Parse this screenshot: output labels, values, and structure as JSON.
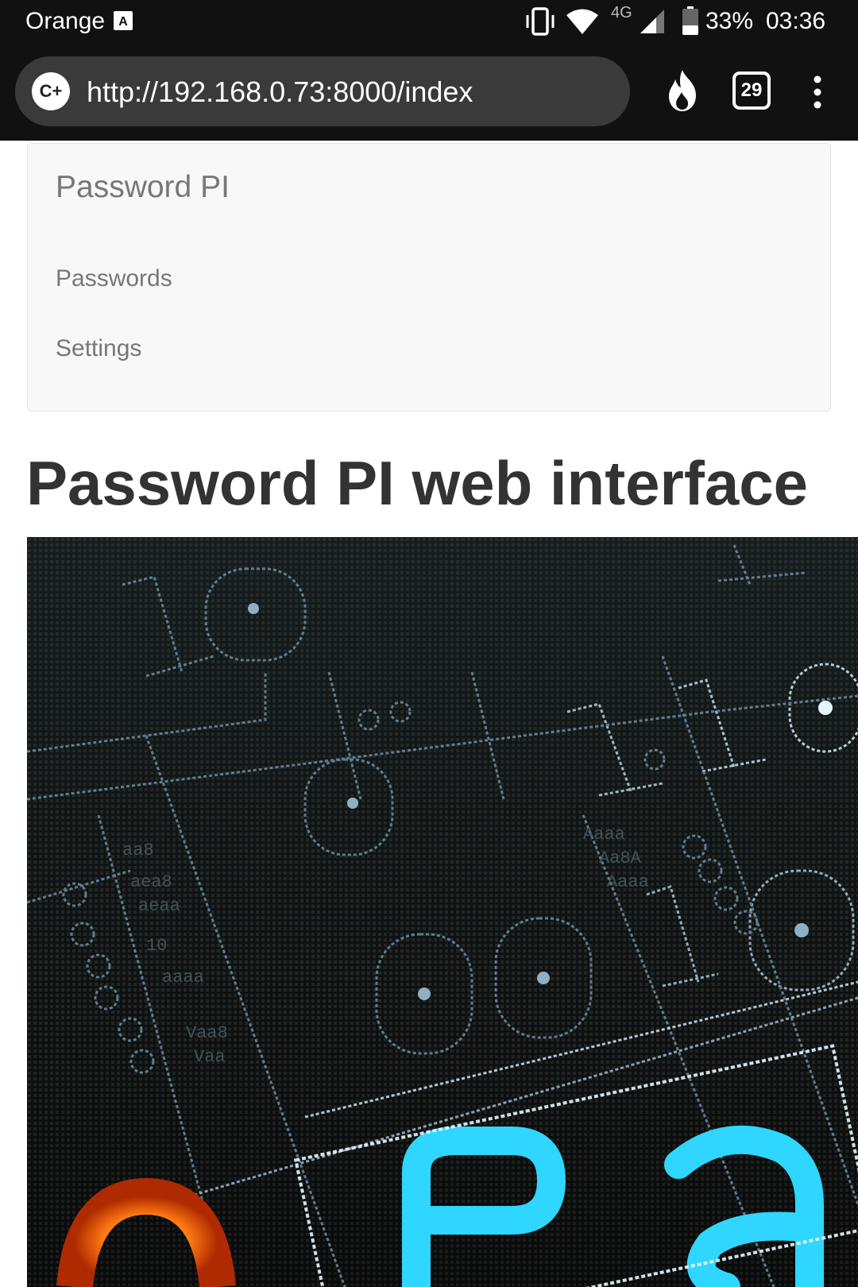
{
  "status_bar": {
    "carrier": "Orange",
    "network_type": "4G",
    "battery": "33%",
    "time": "03:36",
    "icons": [
      "sim-icon",
      "vibrate-icon",
      "wifi-icon",
      "signal-icon",
      "battery-icon"
    ]
  },
  "browser": {
    "url": "http://192.168.0.73:8000/index",
    "site_badge": "C+",
    "tab_count": "29",
    "icons": [
      "flame-icon",
      "tabs-icon",
      "menu-icon"
    ]
  },
  "navbar": {
    "brand": "Password PI",
    "links": [
      {
        "label": "Passwords"
      },
      {
        "label": "Settings"
      }
    ]
  },
  "page": {
    "heading": "Password PI web interface"
  },
  "colors": {
    "status_bar_bg": "#111111",
    "url_bar_bg": "#3a3a3a",
    "navbar_bg": "#f8f8f8",
    "nav_text": "#777777",
    "heading_text": "#333333",
    "hero_dark": "#1a1d1c",
    "hero_blue": "#2fd6ff",
    "hero_orange": "#ff8a1a"
  }
}
